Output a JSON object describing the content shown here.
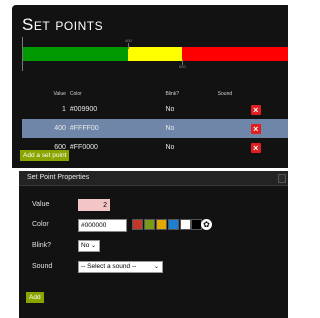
{
  "title": "Set points",
  "bar": {
    "segments": [
      {
        "color": "#009900",
        "from": 0,
        "to": 400
      },
      {
        "color": "#FFFF00",
        "from": 400,
        "to": 600
      },
      {
        "color": "#FF0000",
        "from": 600,
        "to": 1000
      }
    ],
    "labels": {
      "top": "400",
      "bottom": "600",
      "left": "0"
    }
  },
  "table": {
    "headers": {
      "value": "Value",
      "color": "Color",
      "blink": "Blink?",
      "sound": "Sound"
    },
    "rows": [
      {
        "value": "1",
        "color": "#009900",
        "blink": "No",
        "selected": false
      },
      {
        "value": "400",
        "color": "#FFFF00",
        "blink": "No",
        "selected": true
      },
      {
        "value": "600",
        "color": "#FF0000",
        "blink": "No",
        "selected": false
      }
    ],
    "delete_glyph": "×"
  },
  "add_set_point_label": "Add a set point",
  "props": {
    "title": "Set Point Properties",
    "value_label": "Value",
    "value": "2",
    "color_label": "Color",
    "color_value": "#000000",
    "swatches": [
      "#c0392b",
      "#7a9a1a",
      "#e0a800",
      "#1e7fd0",
      "#ffffff",
      "#000000"
    ],
    "blink_label": "Blink?",
    "blink_value": "No",
    "sound_label": "Sound",
    "sound_value": "-- Select a sound --",
    "add_label": "Add"
  },
  "colors": {
    "panel": "#121212",
    "accent": "#8aa400",
    "selected_row": "#6f86a8",
    "delete": "#e02020"
  }
}
